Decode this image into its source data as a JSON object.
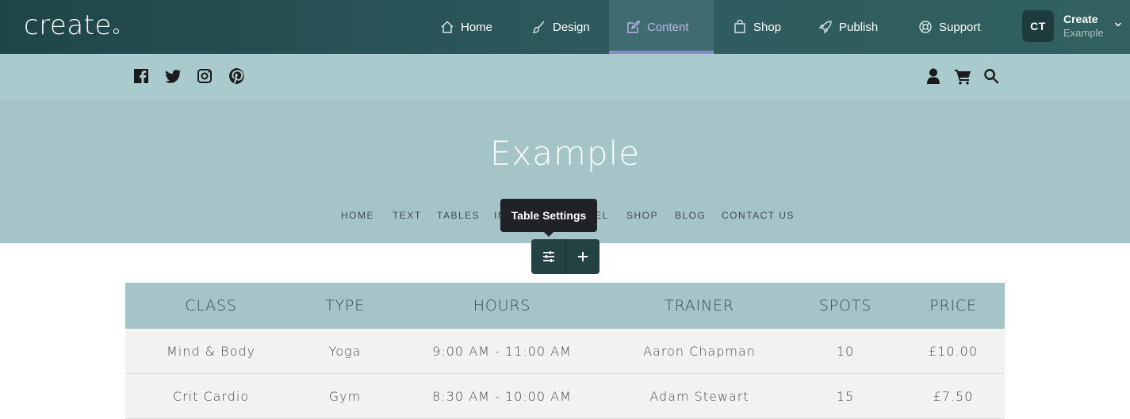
{
  "app": {
    "logo": "create",
    "nav": [
      {
        "label": "Home",
        "icon": "home-icon"
      },
      {
        "label": "Design",
        "icon": "brush-icon"
      },
      {
        "label": "Content",
        "icon": "edit-icon",
        "active": true
      },
      {
        "label": "Shop",
        "icon": "shopping-bag-icon"
      },
      {
        "label": "Publish",
        "icon": "rocket-icon"
      },
      {
        "label": "Support",
        "icon": "lifebuoy-icon"
      }
    ],
    "account": {
      "initials": "CT",
      "name": "Create",
      "site": "Example"
    },
    "colors": {
      "accent": "#8c88d8",
      "bar": "#2e5b5e"
    }
  },
  "social": {
    "left": [
      "facebook-icon",
      "twitter-icon",
      "instagram-icon",
      "pinterest-icon"
    ],
    "right": [
      "user-icon",
      "cart-icon",
      "search-icon"
    ]
  },
  "site": {
    "title": "Example",
    "nav": [
      "HOME",
      "TEXT",
      "TABLES",
      "IN",
      "EL",
      "SHOP",
      "BLOG",
      "CONTACT US"
    ]
  },
  "tooltip": "Table Settings",
  "table": {
    "headers": [
      "CLASS",
      "TYPE",
      "HOURS",
      "TRAINER",
      "SPOTS",
      "PRICE"
    ],
    "rows": [
      [
        "Mind & Body",
        "Yoga",
        "9:00 AM - 11:00 AM",
        "Aaron Chapman",
        "10",
        "£10.00"
      ],
      [
        "Crit Cardio",
        "Gym",
        "8:30 AM - 10:00 AM",
        "Adam Stewart",
        "15",
        "£7.50"
      ]
    ]
  }
}
